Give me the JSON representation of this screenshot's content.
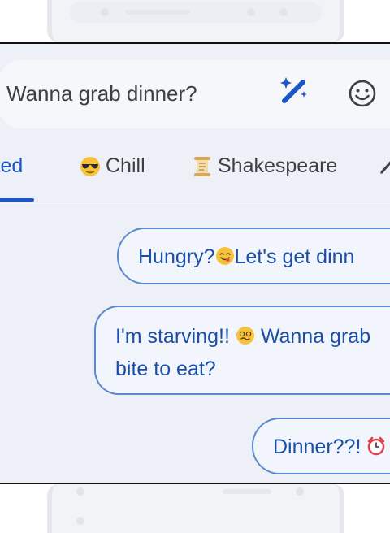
{
  "compose": {
    "message": "Wanna grab dinner?",
    "magic_icon": "magic-wand-icon",
    "emoji_icon": "emoji-smiley-icon"
  },
  "tabs": [
    {
      "label": "ited",
      "emoji": "",
      "selected": true
    },
    {
      "label": "Chill",
      "emoji": "sunglasses-emoji",
      "selected": false
    },
    {
      "label": "Shakespeare",
      "emoji": "scroll-emoji",
      "selected": false
    },
    {
      "label": "",
      "emoji": "pen-icon",
      "selected": false
    }
  ],
  "suggestions": [
    {
      "before": "Hungry?",
      "emoji": "savoring-food-emoji",
      "after": "Let's get dinn"
    },
    {
      "line1_before": "I'm starving!!",
      "emoji": "dizzy-face-emoji",
      "line1_after": "Wanna grab",
      "line2": "bite to eat?"
    },
    {
      "before": "Dinner??!",
      "emoji": "alarm-clock-emoji",
      "after": ""
    }
  ],
  "colors": {
    "accent": "#1a56c4",
    "chip_border": "#5c89c9",
    "panel_bg": "#eef0f8"
  }
}
